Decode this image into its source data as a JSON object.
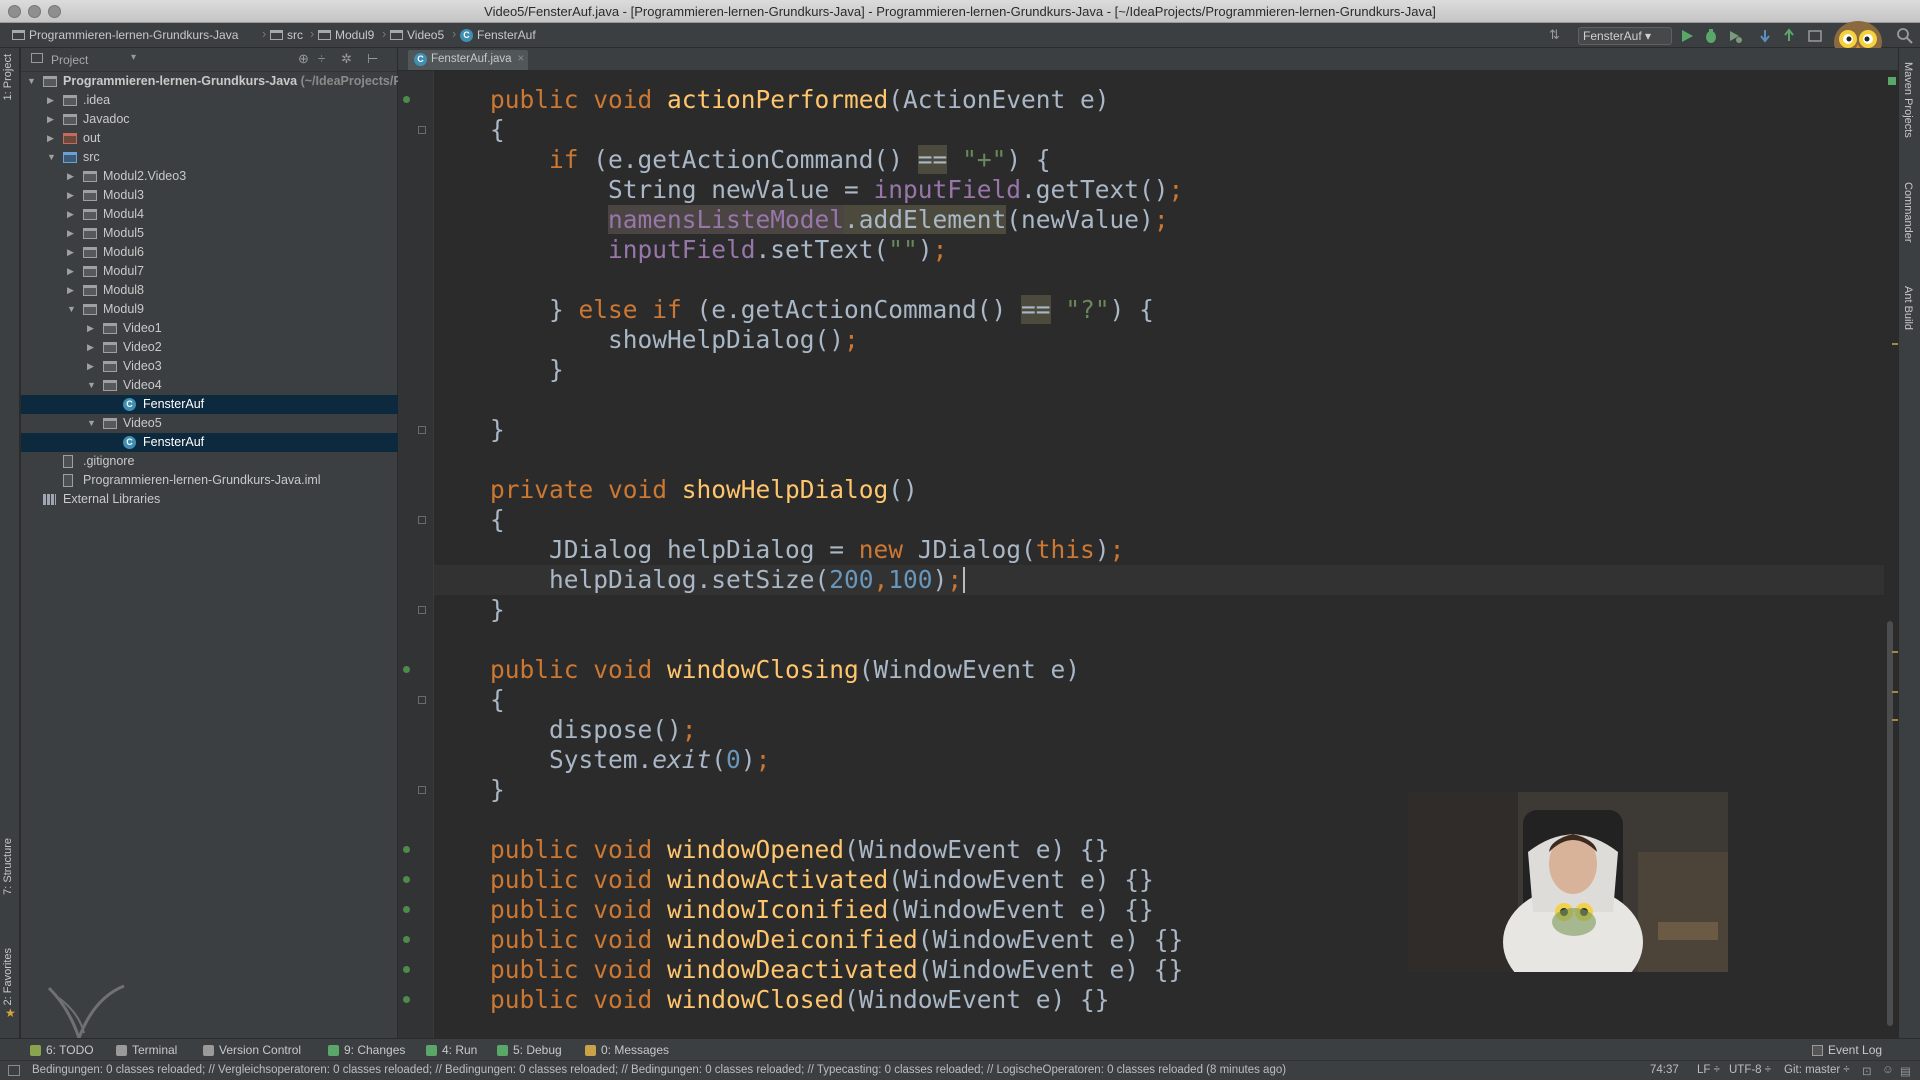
{
  "window": {
    "title": "Video5/FensterAuf.java - [Programmieren-lernen-Grundkurs-Java] - Programmieren-lernen-Grundkurs-Java - [~/IdeaProjects/Programmieren-lernen-Grundkurs-Java]"
  },
  "breadcrumbs": [
    "Programmieren-lernen-Grundkurs-Java",
    "src",
    "Modul9",
    "Video5",
    "FensterAuf"
  ],
  "toolbar": {
    "run_config": "FensterAuf",
    "icons": [
      "run-icon",
      "debug-icon",
      "coverage-icon",
      "vcs-update-icon",
      "vcs-commit-icon",
      "sdk-icon",
      "search-icon"
    ]
  },
  "left_strip": {
    "project_tab": "1: Project",
    "structure_tab": "7: Structure",
    "favorites_tab": "2: Favorites"
  },
  "right_strip": {
    "maven_tab": "Maven Projects",
    "commander_tab": "Commander",
    "ant_tab": "Ant Build"
  },
  "project_panel": {
    "view_label": "Project",
    "tree": [
      {
        "label": "Programmieren-lernen-Grundkurs-Java",
        "suffix": " (~/IdeaProjects/Programmieren-lernen-Grundkurs-Java)",
        "depth": 0,
        "icon": "module",
        "arrow": "open"
      },
      {
        "label": ".idea",
        "depth": 1,
        "icon": "folder",
        "arrow": "closed"
      },
      {
        "label": "Javadoc",
        "depth": 1,
        "icon": "folder",
        "arrow": "closed"
      },
      {
        "label": "out",
        "depth": 1,
        "icon": "excluded",
        "arrow": "closed"
      },
      {
        "label": "src",
        "depth": 1,
        "icon": "src",
        "arrow": "open"
      },
      {
        "label": "Modul2.Video3",
        "depth": 2,
        "icon": "package",
        "arrow": "closed"
      },
      {
        "label": "Modul3",
        "depth": 2,
        "icon": "package",
        "arrow": "closed"
      },
      {
        "label": "Modul4",
        "depth": 2,
        "icon": "package",
        "arrow": "closed"
      },
      {
        "label": "Modul5",
        "depth": 2,
        "icon": "package",
        "arrow": "closed"
      },
      {
        "label": "Modul6",
        "depth": 2,
        "icon": "package",
        "arrow": "closed"
      },
      {
        "label": "Modul7",
        "depth": 2,
        "icon": "package",
        "arrow": "closed"
      },
      {
        "label": "Modul8",
        "depth": 2,
        "icon": "package",
        "arrow": "closed"
      },
      {
        "label": "Modul9",
        "depth": 2,
        "icon": "package",
        "arrow": "open"
      },
      {
        "label": "Video1",
        "depth": 3,
        "icon": "package",
        "arrow": "closed"
      },
      {
        "label": "Video2",
        "depth": 3,
        "icon": "package",
        "arrow": "closed"
      },
      {
        "label": "Video3",
        "depth": 3,
        "icon": "package",
        "arrow": "closed"
      },
      {
        "label": "Video4",
        "depth": 3,
        "icon": "package",
        "arrow": "open"
      },
      {
        "label": "FensterAuf",
        "depth": 4,
        "icon": "class",
        "arrow": "none",
        "selected": true
      },
      {
        "label": "Video5",
        "depth": 3,
        "icon": "package",
        "arrow": "open"
      },
      {
        "label": "FensterAuf",
        "depth": 4,
        "icon": "class",
        "arrow": "none",
        "selected": true
      },
      {
        "label": ".gitignore",
        "depth": 1,
        "icon": "file",
        "arrow": "none"
      },
      {
        "label": "Programmieren-lernen-Grundkurs-Java.iml",
        "depth": 1,
        "icon": "file",
        "arrow": "none"
      },
      {
        "label": "External Libraries",
        "depth": 0,
        "icon": "library",
        "arrow": "none"
      }
    ]
  },
  "editor": {
    "tab_label": "FensterAuf.java",
    "lines": [
      [
        [
          "kw",
          "public void "
        ],
        [
          "method",
          "actionPerformed"
        ],
        [
          "plain",
          "(ActionEvent e)"
        ]
      ],
      [
        [
          "plain",
          "{"
        ]
      ],
      [
        [
          "kw",
          "    if "
        ],
        [
          "plain",
          "(e.getActionCommand() "
        ],
        [
          "hl",
          "=="
        ],
        [
          "plain",
          " "
        ],
        [
          "str",
          "\"+\""
        ],
        [
          "plain",
          ") {"
        ]
      ],
      [
        [
          "plain",
          "        String newValue = "
        ],
        [
          "field",
          "inputField"
        ],
        [
          "plain",
          ".getText()"
        ],
        [
          "kw",
          ";"
        ]
      ],
      [
        [
          "plain",
          "        "
        ],
        [
          "fieldhl",
          "namensListeModel"
        ],
        [
          "hl",
          ".addElement"
        ],
        [
          "plain",
          "(newValue)"
        ],
        [
          "kw",
          ";"
        ]
      ],
      [
        [
          "plain",
          "        "
        ],
        [
          "field",
          "inputField"
        ],
        [
          "plain",
          ".setText("
        ],
        [
          "str",
          "\"\""
        ],
        [
          "plain",
          ")"
        ],
        [
          "kw",
          ";"
        ]
      ],
      [],
      [
        [
          "plain",
          "    } "
        ],
        [
          "kw",
          "else if "
        ],
        [
          "plain",
          "(e.getActionCommand() "
        ],
        [
          "hl",
          "=="
        ],
        [
          "plain",
          " "
        ],
        [
          "str",
          "\"?\""
        ],
        [
          "plain",
          ") {"
        ]
      ],
      [
        [
          "plain",
          "        showHelpDialog()"
        ],
        [
          "kw",
          ";"
        ]
      ],
      [
        [
          "plain",
          "    }"
        ]
      ],
      [],
      [
        [
          "plain",
          "}"
        ]
      ],
      [],
      [
        [
          "kw",
          "private void "
        ],
        [
          "method",
          "showHelpDialog"
        ],
        [
          "plain",
          "()"
        ]
      ],
      [
        [
          "plain",
          "{"
        ]
      ],
      [
        [
          "plain",
          "    JDialog helpDialog = "
        ],
        [
          "kw",
          "new "
        ],
        [
          "plain",
          "JDialog("
        ],
        [
          "kw",
          "this"
        ],
        [
          "plain",
          ")"
        ],
        [
          "kw",
          ";"
        ]
      ],
      [
        [
          "plain",
          "    helpDialog.setSize("
        ],
        [
          "num",
          "200"
        ],
        [
          "kw",
          ","
        ],
        [
          "num",
          "100"
        ],
        [
          "plain",
          ")"
        ],
        [
          "kw",
          ";"
        ]
      ],
      [
        [
          "plain",
          "}"
        ]
      ],
      [],
      [
        [
          "kw",
          "public void "
        ],
        [
          "method",
          "windowClosing"
        ],
        [
          "plain",
          "(WindowEvent e)"
        ]
      ],
      [
        [
          "plain",
          "{"
        ]
      ],
      [
        [
          "plain",
          "    dispose()"
        ],
        [
          "kw",
          ";"
        ]
      ],
      [
        [
          "plain",
          "    System."
        ],
        [
          "static",
          "exit"
        ],
        [
          "plain",
          "("
        ],
        [
          "num",
          "0"
        ],
        [
          "plain",
          ")"
        ],
        [
          "kw",
          ";"
        ]
      ],
      [
        [
          "plain",
          "}"
        ]
      ],
      [],
      [
        [
          "kw",
          "public void "
        ],
        [
          "method",
          "windowOpened"
        ],
        [
          "plain",
          "(WindowEvent e) {}"
        ]
      ],
      [
        [
          "kw",
          "public void "
        ],
        [
          "method",
          "windowActivated"
        ],
        [
          "plain",
          "(WindowEvent e) {}"
        ]
      ],
      [
        [
          "kw",
          "public void "
        ],
        [
          "method",
          "windowIconified"
        ],
        [
          "plain",
          "(WindowEvent e) {}"
        ]
      ],
      [
        [
          "kw",
          "public void "
        ],
        [
          "method",
          "windowDeiconified"
        ],
        [
          "plain",
          "(WindowEvent e) {}"
        ]
      ],
      [
        [
          "kw",
          "public void "
        ],
        [
          "method",
          "windowDeactivated"
        ],
        [
          "plain",
          "(WindowEvent e) {}"
        ]
      ],
      [
        [
          "kw",
          "public void "
        ],
        [
          "method",
          "windowClosed"
        ],
        [
          "plain",
          "(WindowEvent e) {}"
        ]
      ]
    ]
  },
  "bottom_tools": [
    {
      "label": "6: TODO",
      "icon": "todo-icon"
    },
    {
      "label": "Terminal",
      "icon": "terminal-icon"
    },
    {
      "label": "Version Control",
      "icon": "version-control-icon"
    },
    {
      "label": "9: Changes",
      "icon": "changes-icon"
    },
    {
      "label": "4: Run",
      "icon": "run-tool-icon"
    },
    {
      "label": "5: Debug",
      "icon": "debug-tool-icon"
    },
    {
      "label": "0: Messages",
      "icon": "messages-icon"
    }
  ],
  "event_log": "Event Log",
  "status": {
    "message": "Bedingungen: 0 classes reloaded; // Vergleichsoperatoren: 0 classes reloaded; // Bedingungen: 0 classes reloaded; // Bedingungen: 0 classes reloaded; // Typecasting: 0 classes reloaded; // LogischeOperatoren: 0 classes reloaded (8 minutes ago)",
    "position": "74:37",
    "line_separator": "LF ÷",
    "encoding": "UTF-8 ÷",
    "vcs": "Git: master ÷"
  },
  "colors": {
    "keyword": "#cc7832",
    "method": "#ffc66d",
    "field": "#9876aa",
    "string": "#6a8759",
    "number": "#6897bb",
    "selection": "#0d293e",
    "background": "#2b2b2b"
  }
}
